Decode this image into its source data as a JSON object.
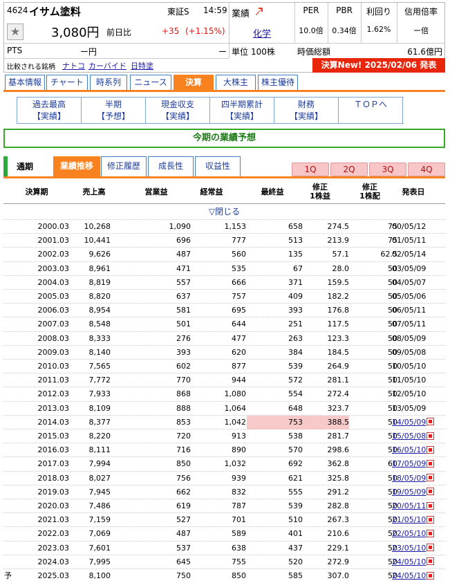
{
  "stock": {
    "code": "4624",
    "name": "イサム塗料",
    "market": "東証S",
    "time": "14:59",
    "price": "3,080円",
    "prev_label": "前日比",
    "change": "+35",
    "change_pct": "(+1.15%)",
    "pts_label": "PTS",
    "pts_value": "ー円",
    "pts_dash": "ー",
    "compare_label": "比較される銘柄",
    "compare_links": [
      "ナトコ",
      "カーバイド",
      "日特塗"
    ]
  },
  "info": {
    "kessan_label": "業績",
    "sector": "化学",
    "unit_label": "単位",
    "unit_value": "100株",
    "per_label": "PER",
    "per_value": "10.0倍",
    "pbr_label": "PBR",
    "pbr_value": "0.34倍",
    "yield_label": "利回り",
    "yield_value": "1.62%",
    "credit_label": "信用倍率",
    "credit_value": "ー倍",
    "mcap_label": "時価総額",
    "mcap_value": "61.6億円",
    "banner": "決算New! 2025/02/06 発表"
  },
  "tabs": [
    "基本情報",
    "チャート",
    "時系列",
    "ニュース",
    "決算",
    "大株主",
    "株主優待"
  ],
  "active_tab": 4,
  "subnav": [
    {
      "top": "過去最高",
      "bottom": "【実績】"
    },
    {
      "top": "半期",
      "bottom": "【予想】"
    },
    {
      "top": "現金収支",
      "bottom": "【実績】"
    },
    {
      "top": "四半期累計",
      "bottom": "【実績】"
    },
    {
      "top": "財務",
      "bottom": "【実績】"
    },
    {
      "top": "ＴＯＰへ",
      "bottom": ""
    }
  ],
  "section_title": "今期の業績予想",
  "subtabs": {
    "period_label": "通期",
    "items": [
      "業績推移",
      "修正履歴",
      "成長性",
      "収益性"
    ],
    "active": 0,
    "quarters": [
      "1Q",
      "2Q",
      "3Q",
      "4Q"
    ]
  },
  "table": {
    "headers": [
      "決算期",
      "売上高",
      "営業益",
      "経常益",
      "最終益",
      "修正\n1株益",
      "修正\n1株配",
      "発表日"
    ],
    "toggle": "▽閉じる",
    "forecast_mark": "予",
    "highlight_color": "#f7c9c9",
    "rows": [
      [
        "2000.03",
        "10,268",
        "1,090",
        "1,153",
        "658",
        "274.5",
        "75",
        "00/05/12"
      ],
      [
        "2001.03",
        "10,441",
        "696",
        "777",
        "513",
        "213.9",
        "75",
        "01/05/11"
      ],
      [
        "2002.03",
        "9,626",
        "487",
        "560",
        "135",
        "57.1",
        "62.5",
        "02/05/14"
      ],
      [
        "2003.03",
        "8,961",
        "471",
        "535",
        "67",
        "28.0",
        "50",
        "03/05/09"
      ],
      [
        "2004.03",
        "8,819",
        "557",
        "666",
        "371",
        "159.5",
        "50",
        "04/05/07"
      ],
      [
        "2005.03",
        "8,820",
        "637",
        "757",
        "409",
        "182.2",
        "50",
        "05/05/06"
      ],
      [
        "2006.03",
        "8,954",
        "581",
        "695",
        "393",
        "176.8",
        "50",
        "06/05/11"
      ],
      [
        "2007.03",
        "8,548",
        "501",
        "644",
        "251",
        "117.5",
        "50",
        "07/05/11"
      ],
      [
        "2008.03",
        "8,333",
        "276",
        "477",
        "263",
        "123.3",
        "50",
        "08/05/09"
      ],
      [
        "2009.03",
        "8,140",
        "393",
        "620",
        "384",
        "184.5",
        "50",
        "09/05/08"
      ],
      [
        "2010.03",
        "7,565",
        "602",
        "877",
        "539",
        "264.9",
        "50",
        "10/05/10"
      ],
      [
        "2011.03",
        "7,772",
        "770",
        "944",
        "572",
        "281.1",
        "50",
        "11/05/10"
      ],
      [
        "2012.03",
        "7,933",
        "868",
        "1,080",
        "554",
        "272.4",
        "50",
        "12/05/10"
      ],
      [
        "2013.03",
        "8,109",
        "888",
        "1,064",
        "648",
        "323.7",
        "50",
        "13/05/09"
      ],
      [
        "2014.03",
        "8,377",
        "853",
        "1,042",
        "753",
        "388.5",
        "50",
        "14/05/09"
      ],
      [
        "2015.03",
        "8,220",
        "720",
        "913",
        "538",
        "281.7",
        "50",
        "15/05/08"
      ],
      [
        "2016.03",
        "8,111",
        "716",
        "890",
        "570",
        "298.6",
        "50",
        "16/05/10"
      ],
      [
        "2017.03",
        "7,994",
        "850",
        "1,032",
        "692",
        "362.8",
        "60",
        "17/05/09"
      ],
      [
        "2018.03",
        "8,027",
        "756",
        "939",
        "621",
        "325.8",
        "50",
        "18/05/09"
      ],
      [
        "2019.03",
        "7,945",
        "662",
        "832",
        "555",
        "291.2",
        "50",
        "19/05/09"
      ],
      [
        "2020.03",
        "7,486",
        "619",
        "787",
        "539",
        "282.8",
        "50",
        "20/05/11"
      ],
      [
        "2021.03",
        "7,159",
        "527",
        "701",
        "510",
        "267.3",
        "50",
        "21/05/10"
      ],
      [
        "2022.03",
        "7,069",
        "487",
        "589",
        "401",
        "210.6",
        "50",
        "22/05/10"
      ],
      [
        "2023.03",
        "7,601",
        "537",
        "638",
        "437",
        "229.1",
        "50",
        "23/05/10"
      ],
      [
        "2024.03",
        "7,995",
        "645",
        "755",
        "520",
        "272.9",
        "50",
        "24/05/10"
      ],
      [
        "2025.03",
        "8,100",
        "750",
        "850",
        "585",
        "307.0",
        "50",
        "24/05/10"
      ]
    ]
  }
}
